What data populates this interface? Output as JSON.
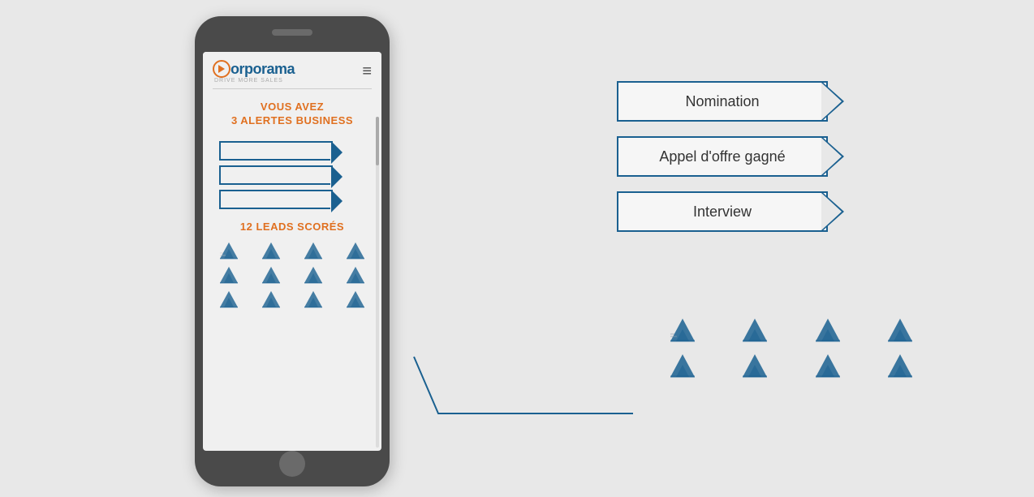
{
  "app": {
    "background_color": "#e8e8e8",
    "logo": {
      "brand": "orporama",
      "tagline": "DRIVE MORE SALES"
    },
    "alerts": {
      "title_line1": "VOUS AVEZ",
      "title_line2": "3 ALERTES BUSINESS"
    },
    "leads": {
      "title": "12 LEADS SCORÉS"
    },
    "labels": [
      {
        "text": "Nomination"
      },
      {
        "text": "Appel d'offre gagné"
      },
      {
        "text": "Interview"
      }
    ],
    "colors": {
      "primary_blue": "#1a6090",
      "accent_orange": "#e07020",
      "background": "#e8e8e8",
      "phone_body": "#4a4a4a",
      "screen_bg": "#f0f0f0"
    },
    "icons": {
      "hamburger": "≡",
      "mountain_count": 12
    }
  }
}
